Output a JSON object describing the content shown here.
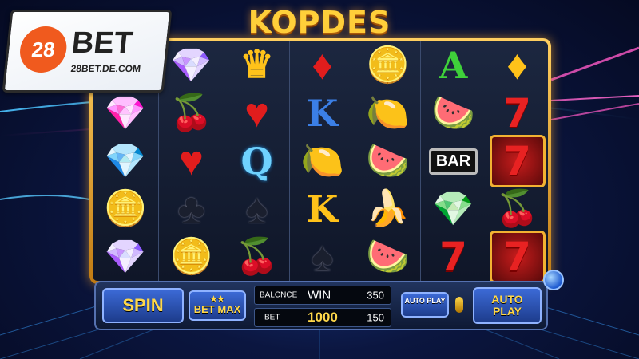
{
  "game": {
    "title": "KOPDES"
  },
  "logo": {
    "number": "28",
    "word": "BET",
    "url": "28BET.DE.COM"
  },
  "symbols": {
    "diamond_purple": "💎",
    "diamond_red": "💎",
    "diamond_blue": "💎",
    "cherry": "🍒",
    "heart": "♥",
    "club": "♣",
    "spade": "♠",
    "suit_diamond": "♦",
    "coins": "🪙",
    "lemon": "🍋",
    "watermelon": "🍉",
    "melon": "🍉",
    "banana": "🍌",
    "bar": "BAR",
    "seven": "7",
    "letter_k": "K",
    "letter_q": "Q",
    "letter_a": "A",
    "crown": "♛"
  },
  "controls": {
    "spin_label": "SPIN",
    "bet_max_stars": "★★",
    "bet_max_label": "BET MAX",
    "balance_label": "BALCNCE",
    "win_label": "WIN",
    "win_value": "350",
    "bet_label": "BET",
    "bet_value": "1000",
    "bet_amount": "150",
    "autoplay_small_label": "AUTO PLAY",
    "autoplay_line1": "AUTO",
    "autoplay_line2": "PLAY"
  }
}
